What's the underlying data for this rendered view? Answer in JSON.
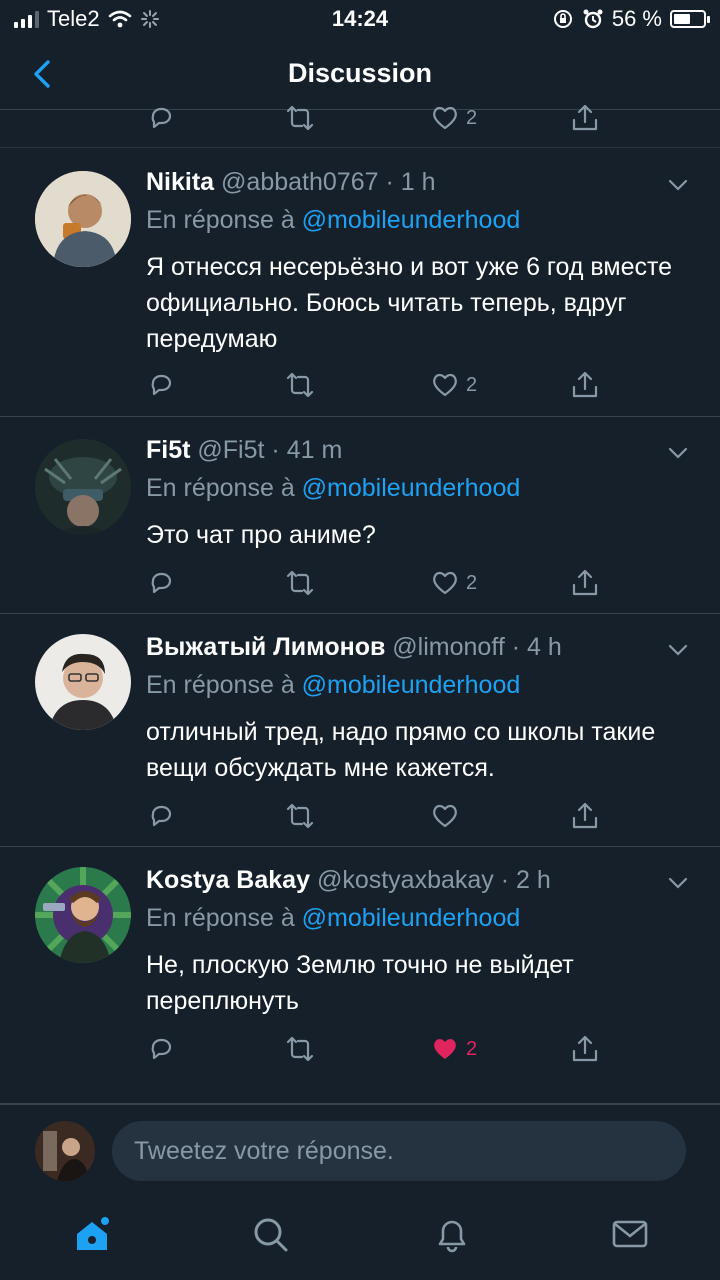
{
  "status": {
    "carrier": "Tele2",
    "time": "14:24",
    "battery": "56 %",
    "battery_level": 0.56
  },
  "header": {
    "title": "Discussion"
  },
  "prev_actions": {
    "like_count": "2"
  },
  "tweets": [
    {
      "name": "Nikita",
      "handle": "@abbath0767",
      "time": "1 h",
      "reply_prefix": "En réponse à",
      "reply_mention": "@mobileunderhood",
      "text": "Я отнесся несерьёзно и вот уже 6 год вместе официально. Боюсь читать теперь, вдруг передумаю",
      "like_count": "2",
      "liked": false
    },
    {
      "name": "Fi5t",
      "handle": "@Fi5t",
      "time": "41 m",
      "reply_prefix": "En réponse à",
      "reply_mention": "@mobileunderhood",
      "text": "Это чат про аниме?",
      "like_count": "2",
      "liked": false
    },
    {
      "name": "Выжатый Лимонов",
      "handle": "@limonoff",
      "time": "4 h",
      "reply_prefix": "En réponse à",
      "reply_mention": "@mobileunderhood",
      "text": "отличный тред, надо прямо со школы такие вещи обсуждать мне кажется.",
      "like_count": "",
      "liked": false
    },
    {
      "name": "Kostya Bakay",
      "handle": "@kostyaxbakay",
      "time": "2 h",
      "reply_prefix": "En réponse à",
      "reply_mention": "@mobileunderhood",
      "text": "Не, плоскую Землю точно не выйдет переплюнуть",
      "like_count": "2",
      "liked": true
    }
  ],
  "composer": {
    "placeholder": "Tweetez votre réponse."
  },
  "colors": {
    "background": "#15202b",
    "accent": "#1da1f2",
    "muted": "#8899a6",
    "like": "#e0245e"
  }
}
